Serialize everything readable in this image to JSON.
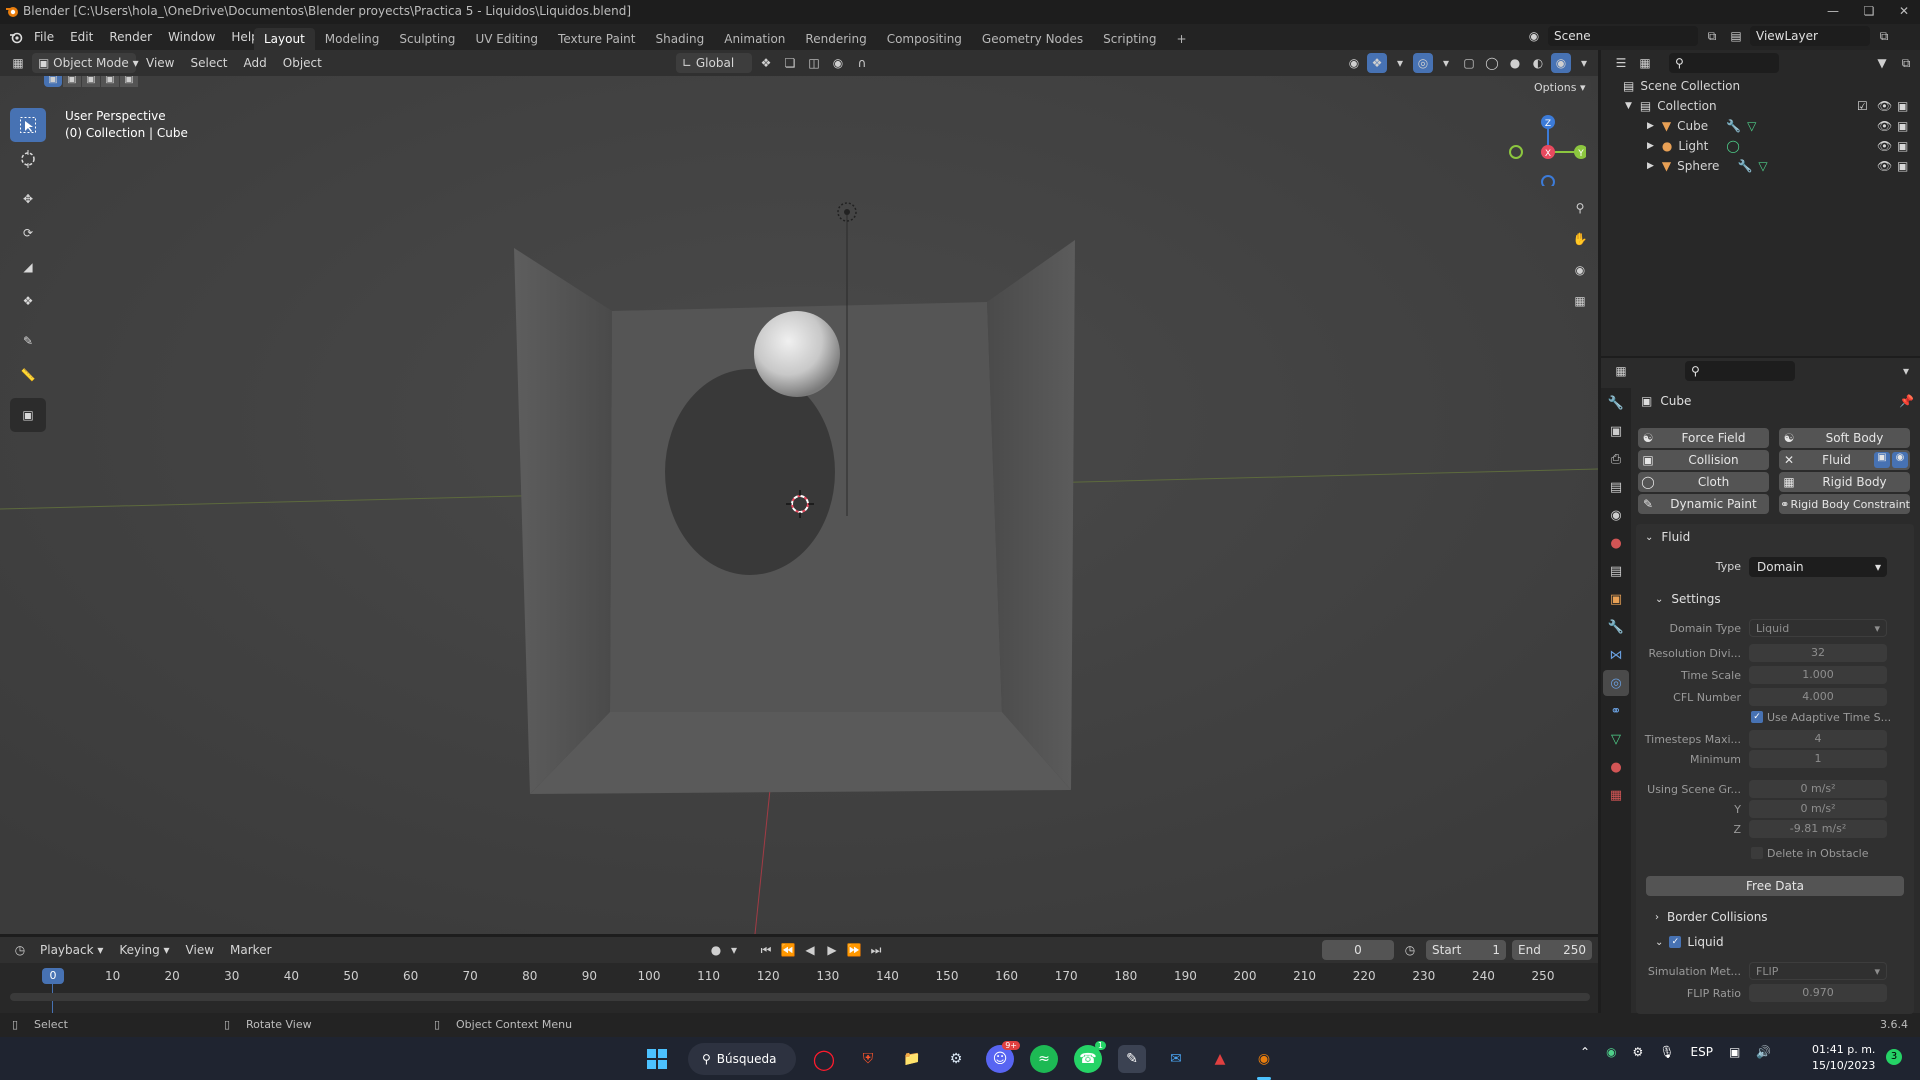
{
  "window": {
    "title": "Blender [C:\\Users\\hola_\\OneDrive\\Documentos\\Blender proyects\\Practica 5 - Liquidos\\Liquidos.blend]"
  },
  "menu": {
    "items": [
      "File",
      "Edit",
      "Render",
      "Window",
      "Help"
    ],
    "workspaces": [
      "Layout",
      "Modeling",
      "Sculpting",
      "UV Editing",
      "Texture Paint",
      "Shading",
      "Animation",
      "Rendering",
      "Compositing",
      "Geometry Nodes",
      "Scripting"
    ],
    "active_workspace": "Layout",
    "add_tab": "+",
    "scene": "Scene",
    "view_layer": "ViewLayer"
  },
  "viewport_header": {
    "mode": "Object Mode",
    "menus": [
      "View",
      "Select",
      "Add",
      "Object"
    ],
    "orientation": "Global",
    "options": "Options"
  },
  "viewport": {
    "perspective": "User Perspective",
    "collection": "(0) Collection | Cube",
    "gizmo": {
      "z": "Z",
      "y": "Y",
      "x": "X"
    },
    "tools": [
      "select-box-icon",
      "cursor-icon",
      "move-icon",
      "rotate-icon",
      "scale-icon",
      "transform-icon",
      "annotate-icon",
      "measure-icon",
      "add-cube-icon"
    ]
  },
  "timeline": {
    "menus": [
      "Playback",
      "Keying",
      "View",
      "Marker"
    ],
    "current_frame": "0",
    "start_label": "Start",
    "start": "1",
    "end_label": "End",
    "end": "250",
    "ticks": [
      "0",
      "10",
      "20",
      "30",
      "40",
      "50",
      "60",
      "70",
      "80",
      "90",
      "100",
      "110",
      "120",
      "130",
      "140",
      "150",
      "160",
      "170",
      "180",
      "190",
      "200",
      "210",
      "220",
      "230",
      "240",
      "250"
    ]
  },
  "status": {
    "select": "Select",
    "rotate": "Rotate View",
    "context": "Object Context Menu",
    "version": "3.6.4"
  },
  "outliner": {
    "root": "Scene Collection",
    "collection": "Collection",
    "items": [
      "Cube",
      "Light",
      "Sphere"
    ]
  },
  "properties": {
    "object": "Cube",
    "physics_buttons": [
      "Force Field",
      "Soft Body",
      "Collision",
      "Fluid",
      "Cloth",
      "Rigid Body",
      "Dynamic Paint",
      "Rigid Body Constraint"
    ],
    "fluid": {
      "title": "Fluid",
      "type_label": "Type",
      "type": "Domain",
      "settings_title": "Settings",
      "domain_type_label": "Domain Type",
      "domain_type": "Liquid",
      "resolution_label": "Resolution Divi...",
      "resolution": "32",
      "time_scale_label": "Time Scale",
      "time_scale": "1.000",
      "cfl_label": "CFL Number",
      "cfl": "4.000",
      "adaptive_label": "Use Adaptive Time S...",
      "timesteps_max_label": "Timesteps Maxi...",
      "timesteps_max": "4",
      "minimum_label": "Minimum",
      "minimum": "1",
      "gravity_label": "Using Scene Gr...",
      "gravity_x": "0 m/s²",
      "gravity_y_label": "Y",
      "gravity_y": "0 m/s²",
      "gravity_z_label": "Z",
      "gravity_z": "-9.81 m/s²",
      "delete_obstacle_label": "Delete in Obstacle",
      "free_data": "Free Data",
      "border_collisions": "Border Collisions",
      "liquid": "Liquid",
      "sim_method_label": "Simulation Met...",
      "sim_method": "FLIP",
      "flip_ratio_label": "FLIP Ratio",
      "flip_ratio": "0.970"
    }
  },
  "taskbar": {
    "search": "Búsqueda",
    "lang": "ESP",
    "time": "01:41 p. m.",
    "date": "15/10/2023",
    "notifications": "3",
    "discord_badge": "9+",
    "whatsapp_badge": "1"
  },
  "colors": {
    "accent": "#4772b3",
    "viewport_bg": "#3f3f3f",
    "panel_bg": "#2b2b2b",
    "header_bg": "#303030",
    "axis_x": "#e84a5f",
    "axis_y": "#8cc63f",
    "axis_z": "#3c7bd8"
  }
}
